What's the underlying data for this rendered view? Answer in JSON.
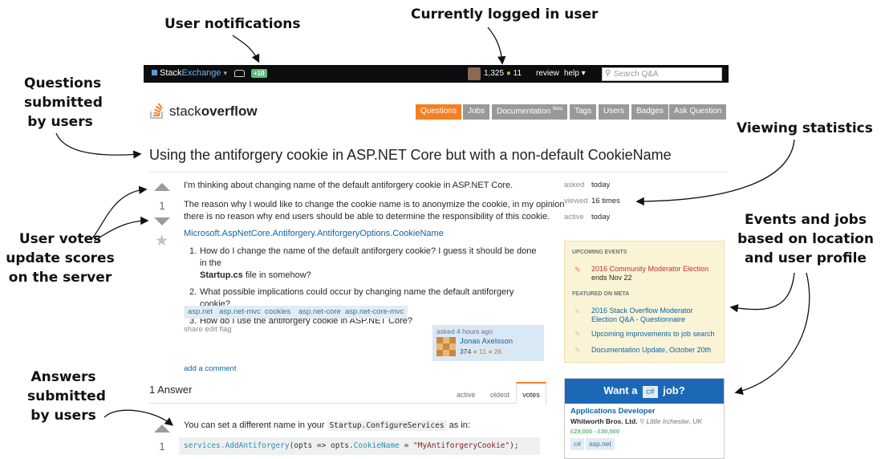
{
  "annotations": {
    "user_notifications": "User notifications",
    "currently_logged_in": "Currently logged in user",
    "questions_l1": "Questions",
    "questions_l2": "submitted",
    "questions_l3": "by users",
    "viewing_statistics": "Viewing statistics",
    "votes_l1": "User votes",
    "votes_l2": "update scores",
    "votes_l3": "on the server",
    "events_l1": "Events and jobs",
    "events_l2": "based on location",
    "events_l3": "and user profile",
    "answers_l1": "Answers",
    "answers_l2": "submitted",
    "answers_l3": "by users"
  },
  "topbar": {
    "brand_a": "Stack",
    "brand_b": "Exchange",
    "brand_caret": "▾",
    "notification_count": "+10",
    "reputation": "1,325",
    "gold_dot": "●",
    "badge_count": "11",
    "review": "review",
    "help": "help ▾",
    "search_placeholder": "Search Q&A"
  },
  "logo": {
    "prefix": "stack",
    "suffix": "overflow"
  },
  "nav": {
    "questions": "Questions",
    "jobs": "Jobs",
    "documentation": "Documentation",
    "beta": "Beta",
    "tags": "Tags",
    "users": "Users",
    "badges": "Badges",
    "ask": "Ask Question"
  },
  "question": {
    "title": "Using the antiforgery cookie in ASP.NET Core but with a non-default CookieName",
    "score": "1",
    "p1": "I'm thinking about changing name of the default antiforgery cookie in ASP.NET Core.",
    "p2a": "The reason why I would like to change the cookie name is to anonymize the cookie, in my opinion",
    "p2b": "there is no reason why end users should be able to determine the responsibility of this cookie.",
    "link": "Microsoft.AspNetCore.Antiforgery.AntiforgeryOptions.CookieName",
    "items": [
      {
        "n": "1.",
        "a": "How do I change the name of the default antiforgery cookie? I guess it should be done in the",
        "b_bold": "Startup.cs",
        "b_rest": " file in somehow?"
      },
      {
        "n": "2.",
        "a": "What possible implications could occur by changing name the default antiforgery cookie?"
      },
      {
        "n": "3.",
        "a": "How do I use the antiforgery cookie in ASP.NET Core?"
      }
    ],
    "tags": [
      "asp.net",
      "asp.net-mvc",
      "cookies",
      "asp.net-core",
      "asp.net-core-mvc"
    ],
    "post_menu": "share  edit  flag",
    "add_comment": "add a comment",
    "asked": "asked 4 hours ago",
    "user_name": "Jonas Axelsson",
    "user_rep": "374",
    "user_silver": "● 11",
    "user_bronze": "● 26"
  },
  "stats": {
    "asked_k": "asked",
    "asked_v": "today",
    "viewed_k": "viewed",
    "viewed_v": "16 times",
    "active_k": "active",
    "active_v": "today"
  },
  "events": {
    "upcoming": "UPCOMING EVENTS",
    "event1": "2016 Community Moderator Election",
    "event1_sub": "ends Nov 22",
    "featured": "FEATURED ON META",
    "meta1a": "2016 Stack Overflow Moderator",
    "meta1b": "Election Q&A - Questionnaire",
    "meta2": "Upcoming improvements to job search",
    "meta3": "Documentation Update, October 20th"
  },
  "jobs": {
    "want_a": "Want a",
    "lang": "c#",
    "job": "job?",
    "title": "Applications Developer",
    "company": "Whitworth Bros. Ltd.",
    "location": "Little Irchester, UK",
    "salary": "£29,000 - £30,000",
    "tags": [
      "c#",
      "asp.net"
    ]
  },
  "answers": {
    "count": "1 Answer",
    "tab_active": "active",
    "tab_oldest": "oldest",
    "tab_votes": "votes",
    "score": "1",
    "text_a": "You can set a different name in your",
    "code_inline": "Startup.ConfigureServices",
    "text_b": "as in:",
    "code_fn": "services.AddAntiforgery",
    "code_mid": "(opts => opts.",
    "code_prop": "CookieName",
    "code_eq": " = ",
    "code_str": "\"MyAntiforgeryCookie\"",
    "code_end": ");"
  }
}
